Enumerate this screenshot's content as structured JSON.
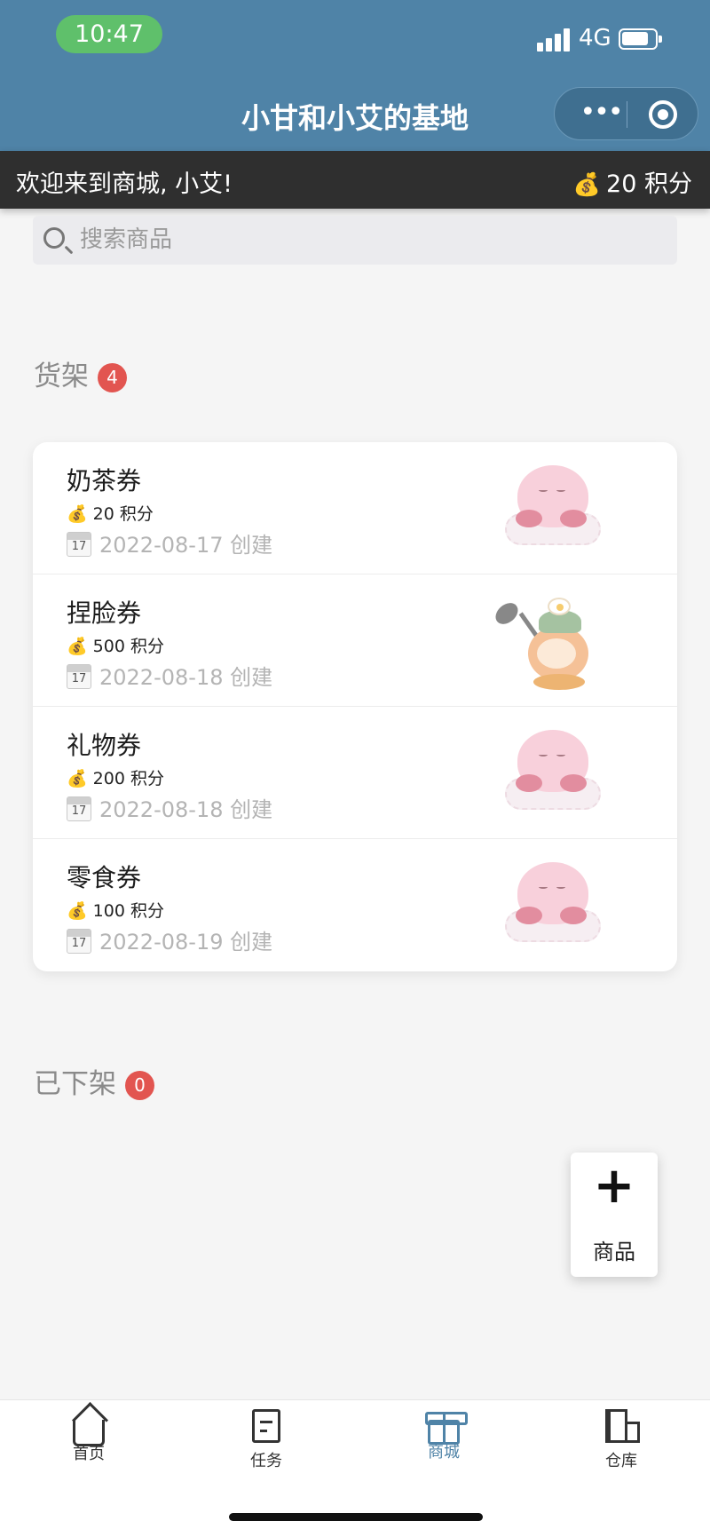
{
  "status_bar": {
    "time": "10:47",
    "network": "4G"
  },
  "header": {
    "title": "小甘和小艾的基地"
  },
  "welcome": {
    "message": "欢迎来到商城, 小艾!",
    "points": "20 积分"
  },
  "search": {
    "placeholder": "搜索商品",
    "value": ""
  },
  "shelf": {
    "title": "货架",
    "count": "4",
    "items": [
      {
        "name": "奶茶券",
        "price": "20 积分",
        "date": "2022-08-17 创建",
        "image": "kirby-on-cloud"
      },
      {
        "name": "捏脸券",
        "price": "500 积分",
        "date": "2022-08-18 创建",
        "image": "waddle-dee-with-pan"
      },
      {
        "name": "礼物券",
        "price": "200 积分",
        "date": "2022-08-18 创建",
        "image": "kirby-on-cloud"
      },
      {
        "name": "零食券",
        "price": "100 积分",
        "date": "2022-08-19 创建",
        "image": "kirby-on-cloud"
      }
    ]
  },
  "off_shelf": {
    "title": "已下架",
    "count": "0"
  },
  "fab": {
    "label": "商品"
  },
  "tabs": [
    {
      "label": "首页",
      "icon": "home-icon"
    },
    {
      "label": "任务",
      "icon": "task-icon"
    },
    {
      "label": "商城",
      "icon": "gift-icon",
      "active": true
    },
    {
      "label": "仓库",
      "icon": "warehouse-icon"
    }
  ],
  "calendar_glyph": "17",
  "colors": {
    "header": "#4f83a7",
    "accent": "#4f83a7",
    "badge": "#e25550",
    "time_pill": "#5fc06b"
  }
}
